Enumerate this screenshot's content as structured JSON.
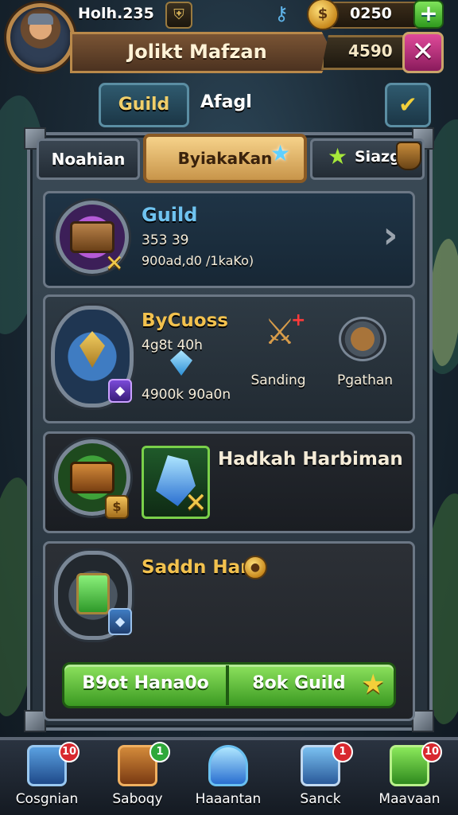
{
  "header": {
    "player_name": "Holh.235",
    "coin_value": "0250",
    "banner_title": "Jolikt Mafzan",
    "gem_value": "4590",
    "close_label": "✕",
    "plus_label": "+"
  },
  "top_tabs": {
    "guild": "Guild",
    "afagl": "Afagl"
  },
  "sub_tabs": [
    "Noahian",
    "ByiakaKan",
    "Siazg"
  ],
  "panels": {
    "guild": {
      "title": "Guild",
      "line1": "353 39",
      "line2": "900ad,d0 /1kaKo)"
    },
    "bycuoss": {
      "title": "ByCuoss",
      "line1": "4g8t 40h",
      "line2": "4900k 90a0n",
      "reward_1_label": "Sanding",
      "reward_2_label": "Pgathan"
    },
    "hadkah": {
      "title": "Hadkah Harbiman"
    },
    "saddn": {
      "title": "Saddn Han",
      "button_left": "B9ot Hana0o",
      "button_right": "8ok Guild"
    }
  },
  "bottom_nav": [
    {
      "label": "Cosgnian",
      "badge": "10",
      "badge_color": "#d8282f",
      "icon": "blue-shield-icon"
    },
    {
      "label": "Saboqy",
      "badge": "1",
      "badge_color": "#2fa83a",
      "icon": "treasure-chest-icon"
    },
    {
      "label": "Haaantan",
      "badge": "",
      "badge_color": "",
      "icon": "crystal-icon"
    },
    {
      "label": "Sanck",
      "badge": "1",
      "badge_color": "#d8282f",
      "icon": "blue-gem-shield-icon"
    },
    {
      "label": "Maavaan",
      "badge": "10",
      "badge_color": "#d8282f",
      "icon": "green-crystals-icon"
    }
  ],
  "colors": {
    "accent_gold": "#f2c14e",
    "accent_blue": "#6fc3f0",
    "active_tab": "#f6d28a",
    "action_green": "#5fc23a"
  }
}
